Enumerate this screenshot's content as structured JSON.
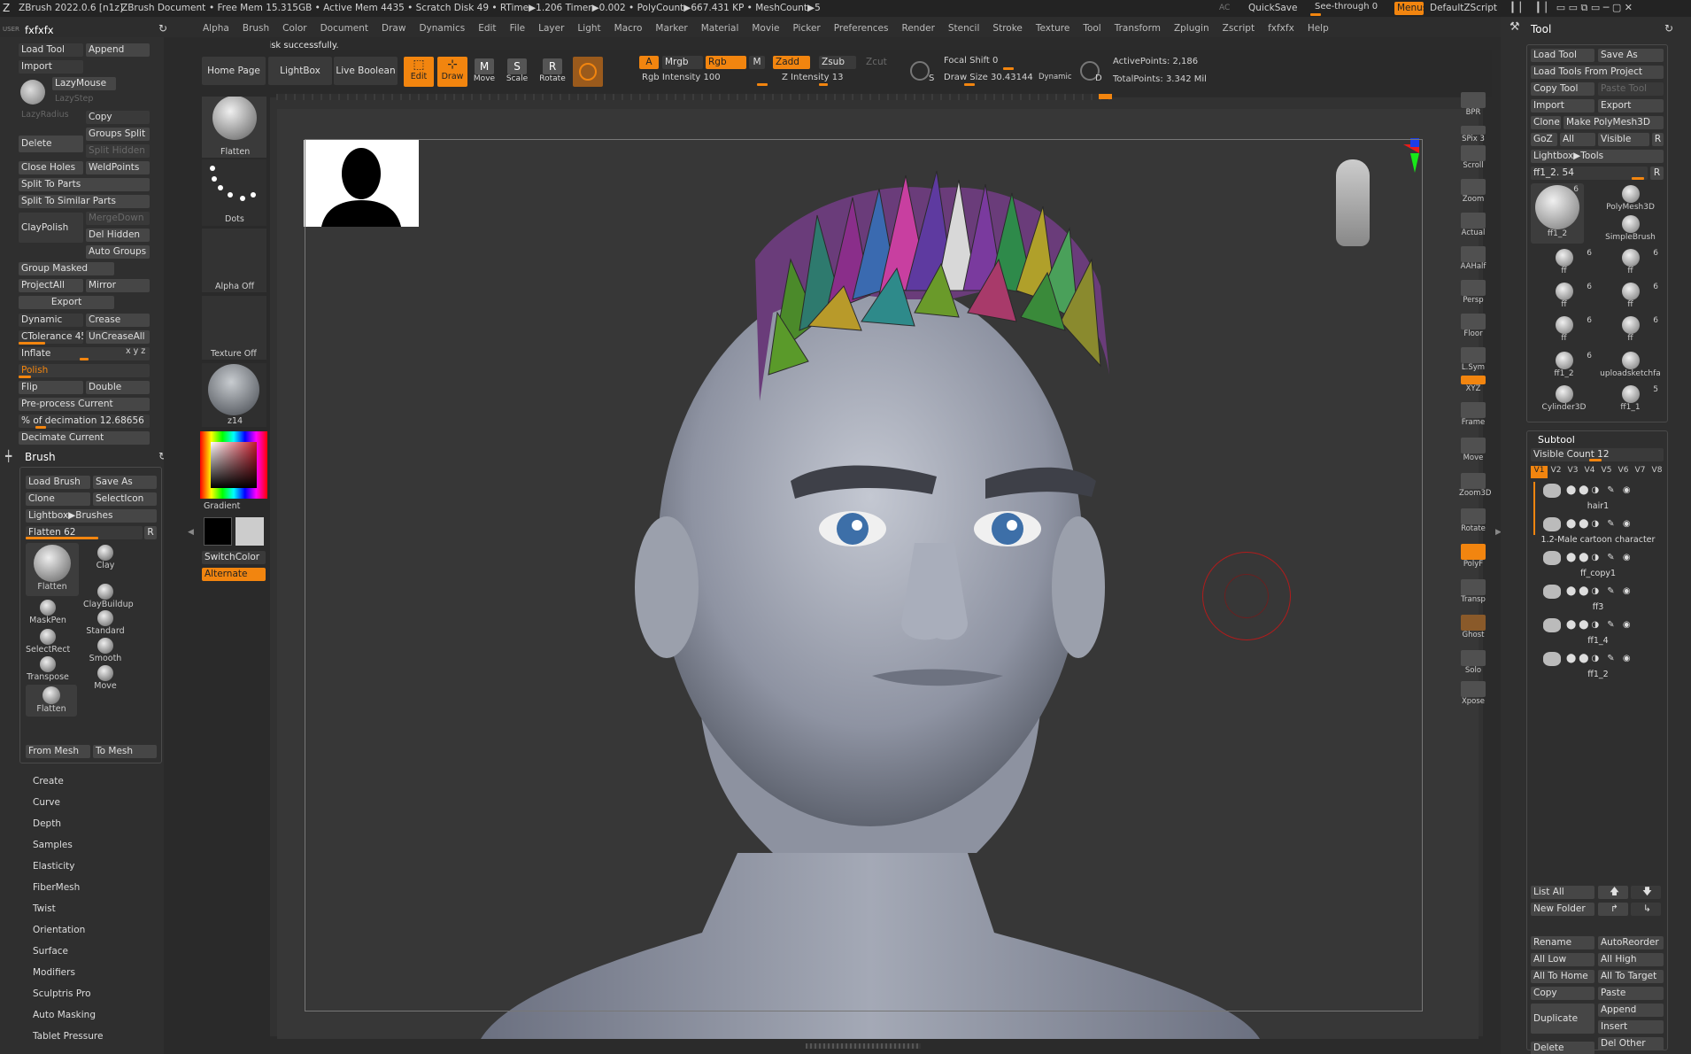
{
  "title_bar": {
    "app_name": "ZBrush 2022.0.6 [n1z]",
    "doc_name": "ZBrush Document",
    "stats": "• Free Mem 15.315GB • Active Mem 4435 • Scratch Disk 49 • RTime▶1.206 Timer▶0.002 • PolyCount▶667.431 KP • MeshCount▶5",
    "ac": "AC",
    "quicksave": "QuickSave",
    "see_through": "See-through   0",
    "menus": "Menus",
    "zscript": "DefaultZScript"
  },
  "menu_bar": [
    "Alpha",
    "Brush",
    "Color",
    "Document",
    "Draw",
    "Dynamics",
    "Edit",
    "File",
    "Layer",
    "Light",
    "Macro",
    "Marker",
    "Material",
    "Movie",
    "Picker",
    "Preferences",
    "Render",
    "Stencil",
    "Stroke",
    "Texture",
    "Tool",
    "Transform",
    "Zplugin",
    "Zscript",
    "fxfxfx",
    "Help"
  ],
  "notification": "File saved to disk successfully.",
  "left_panel": {
    "user": "USER",
    "title": "fxfxfx",
    "load_tool": "Load Tool",
    "append": "Append",
    "import": "Import",
    "lazymouse": "LazyMouse",
    "lazystep": "LazyStep",
    "lazyradius": "LazyRadius",
    "copy": "Copy",
    "delete": "Delete",
    "groups_split": "Groups Split",
    "split_hidden": "Split Hidden",
    "close_holes": "Close Holes",
    "weldpoints": "WeldPoints",
    "split_to_parts": "Split To Parts",
    "split_similar": "Split To Similar Parts",
    "claypolish": "ClayPolish",
    "mergedown": "MergeDown",
    "del_hidden": "Del Hidden",
    "auto_groups": "Auto Groups",
    "group_masked": "Group Masked",
    "projectall": "ProjectAll",
    "mirror": "Mirror",
    "export": "Export",
    "dynamic": "Dynamic",
    "crease": "Crease",
    "ctolerance": "CTolerance 45",
    "uncreaseall": "UnCreaseAll",
    "inflate": "Inflate",
    "xyz": "x y z",
    "polish": "Polish",
    "flip": "Flip",
    "double": "Double",
    "preprocess": "Pre-process Current",
    "decimation": "% of decimation 12.68656",
    "decimate": "Decimate Current"
  },
  "brush_panel": {
    "title": "Brush",
    "load_brush": "Load Brush",
    "save_as": "Save As",
    "clone": "Clone",
    "selecticon": "SelectIcon",
    "lightbox": "Lightbox▶Brushes",
    "flatten_slider": "Flatten  62",
    "r": "R",
    "brushes": [
      {
        "name": "Flatten"
      },
      {
        "name": "Clay"
      },
      {
        "name": "ClayBuildup"
      },
      {
        "name": "MaskPen"
      },
      {
        "name": "Standard"
      },
      {
        "name": "SelectRect"
      },
      {
        "name": "Smooth"
      },
      {
        "name": "Transpose"
      },
      {
        "name": "Move"
      },
      {
        "name": "Flatten"
      }
    ],
    "from_mesh": "From Mesh",
    "to_mesh": "To Mesh"
  },
  "sub_menus": [
    "Create",
    "Curve",
    "Depth",
    "Samples",
    "Elasticity",
    "FiberMesh",
    "Twist",
    "Orientation",
    "Surface",
    "Modifiers",
    "Sculptris Pro",
    "Auto Masking",
    "Tablet Pressure"
  ],
  "shelf": {
    "flatten": "Flatten",
    "dots": "Dots",
    "alpha_off": "Alpha Off",
    "texture_off": "Texture Off",
    "material": "z14",
    "gradient": "Gradient",
    "switchcolor": "SwitchColor",
    "alternate": "Alternate",
    "main_color": "#000000",
    "secondary_color": "#cccccc"
  },
  "top_shelf": {
    "home_page": "Home Page",
    "lightbox": "LightBox",
    "live_boolean": "Live Boolean",
    "edit": "Edit",
    "draw": "Draw",
    "move": "Move",
    "scale": "Scale",
    "rotate": "Rotate",
    "a": "A",
    "mrgb": "Mrgb",
    "rgb": "Rgb",
    "m": "M",
    "rgb_intensity": "Rgb Intensity 100",
    "zadd": "Zadd",
    "zsub": "Zsub",
    "zcut": "Zcut",
    "z_intensity": "Z Intensity 13",
    "focal_shift": "Focal Shift 0",
    "draw_size": "Draw Size 30.43144",
    "dynamic": "Dynamic",
    "s": "S",
    "d": "D",
    "active_points": "ActivePoints: 2,186",
    "total_points": "TotalPoints: 3.342 Mil"
  },
  "right_shelf": [
    "BPR",
    "SPix 3",
    "Scroll",
    "Zoom",
    "Actual",
    "AAHalf",
    "Persp",
    "Floor",
    "L.Sym",
    "XYZ",
    "Frame",
    "Move",
    "Zoom3D",
    "Rotate",
    "PolyF",
    "Transp",
    "Ghost",
    "Solo",
    "Xpose"
  ],
  "tool_panel": {
    "title": "Tool",
    "load_tool": "Load Tool",
    "save_as": "Save As",
    "load_from_project": "Load Tools From Project",
    "copy_tool": "Copy Tool",
    "paste_tool": "Paste Tool",
    "import": "Import",
    "export": "Export",
    "clone": "Clone",
    "make_polymesh": "Make PolyMesh3D",
    "goz": "GoZ",
    "all": "All",
    "visible": "Visible",
    "r": "R",
    "lightbox_tools": "Lightbox▶Tools",
    "ff1_slider": "ff1_2. 54",
    "tools": [
      {
        "name": "ff1_2",
        "count": "6"
      },
      {
        "name": "PolyMesh3D",
        "count": ""
      },
      {
        "name": "SimpleBrush",
        "count": ""
      },
      {
        "name": "ff",
        "count": "6"
      },
      {
        "name": "ff",
        "count": "6"
      },
      {
        "name": "ff",
        "count": "6"
      },
      {
        "name": "ff",
        "count": "6"
      },
      {
        "name": "ff",
        "count": "6"
      },
      {
        "name": "ff",
        "count": "6"
      },
      {
        "name": "ff1_2",
        "count": "6"
      },
      {
        "name": "uploadsketchfa",
        "count": ""
      },
      {
        "name": "Cylinder3D",
        "count": ""
      },
      {
        "name": "ff1_1",
        "count": "5"
      }
    ]
  },
  "subtool": {
    "title": "Subtool",
    "visible_count": "Visible Count 12",
    "versions": [
      "V1",
      "V2",
      "V3",
      "V4",
      "V5",
      "V6",
      "V7",
      "V8"
    ],
    "items": [
      {
        "name": "hair1"
      },
      {
        "name": "1.2-Male cartoon character"
      },
      {
        "name": "ff_copy1"
      },
      {
        "name": "ff3"
      },
      {
        "name": "ff1_4"
      },
      {
        "name": "ff1_2"
      }
    ],
    "list_all": "List All",
    "new_folder": "New Folder",
    "rename": "Rename",
    "autoreorder": "AutoReorder",
    "all_low": "All Low",
    "all_high": "All High",
    "all_to_home": "All To Home",
    "all_to_target": "All To Target",
    "copy": "Copy",
    "paste": "Paste",
    "duplicate": "Duplicate",
    "append": "Append",
    "insert": "Insert",
    "delete": "Delete",
    "del_other": "Del Other"
  },
  "colors": {
    "accent": "#f2850f",
    "background": "#2b2b2b",
    "panel": "#363636",
    "button": "#464646"
  }
}
